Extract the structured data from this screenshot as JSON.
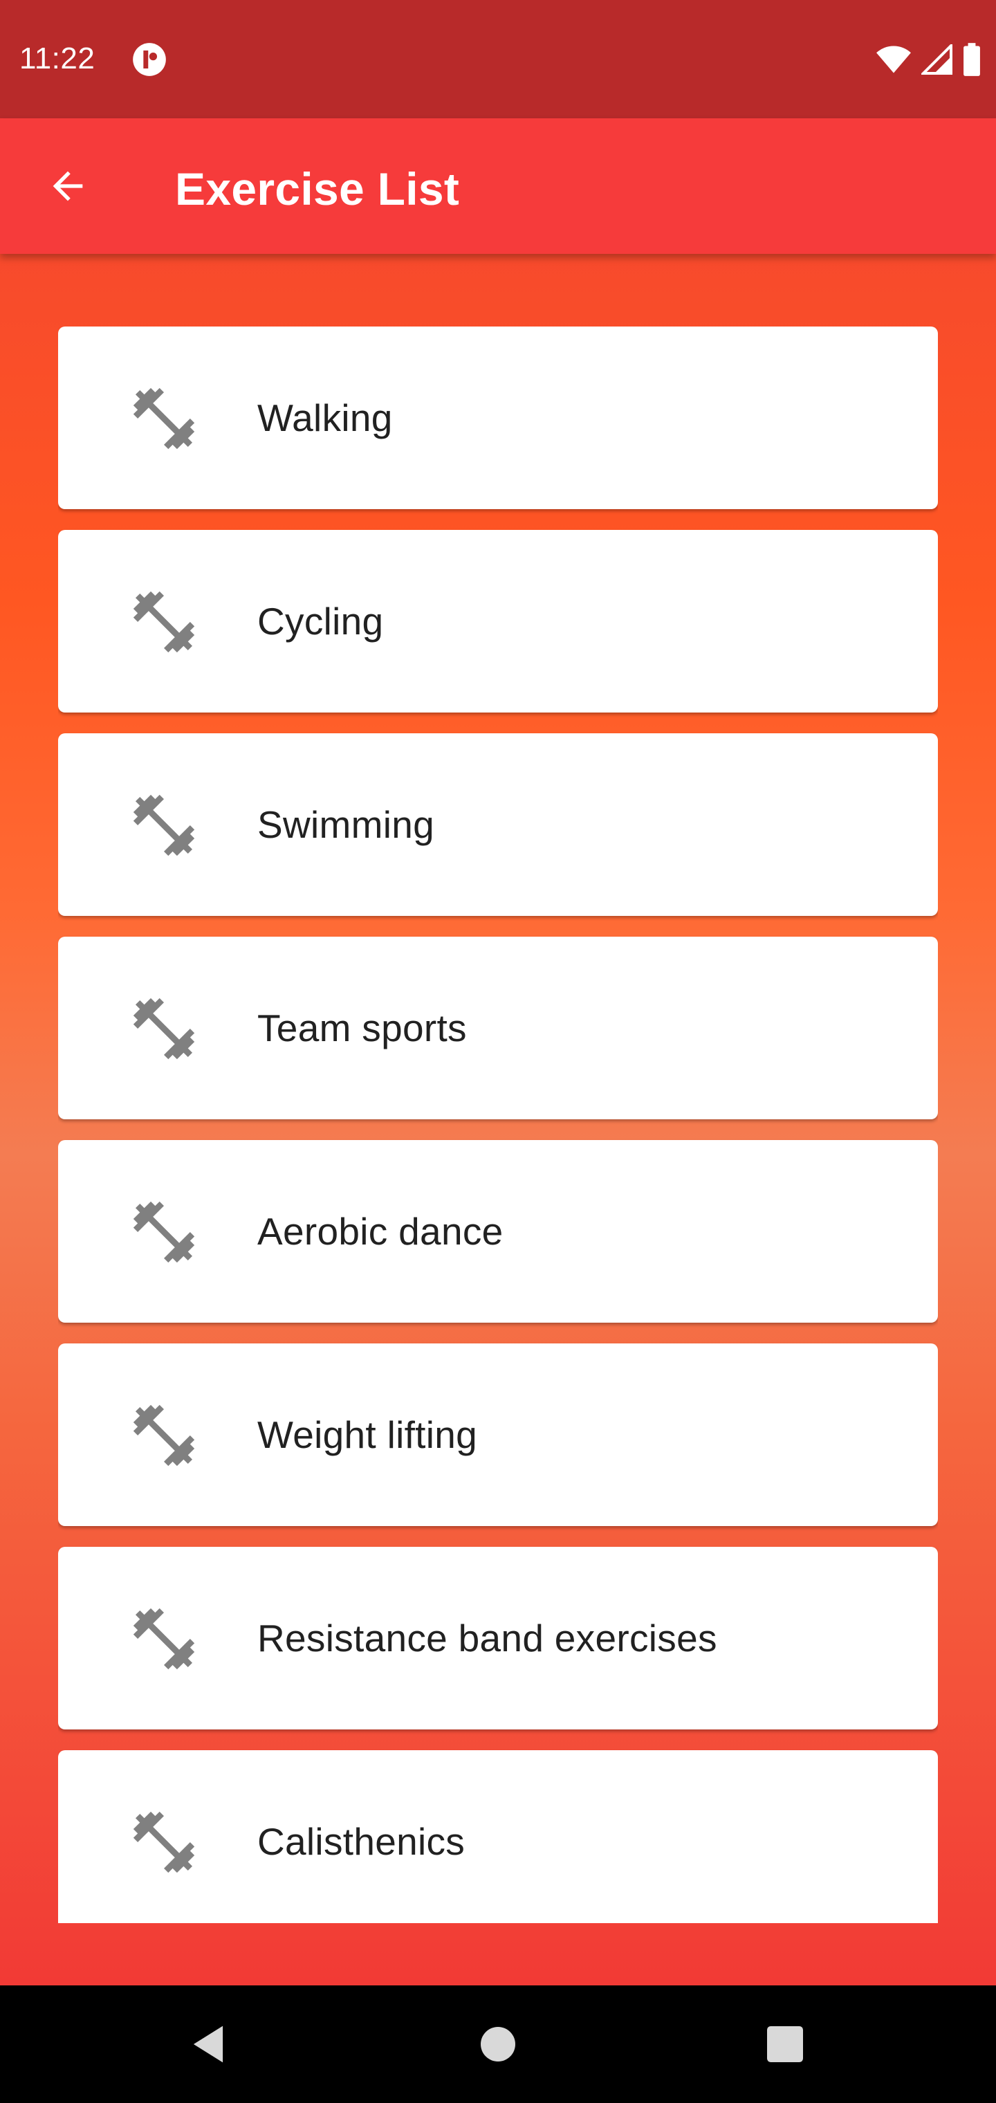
{
  "status_bar": {
    "time": "11:22",
    "icons": [
      "app-notification-icon",
      "wifi-icon",
      "cell-signal-icon",
      "battery-icon"
    ]
  },
  "app_bar": {
    "back_icon": "arrow-back-icon",
    "title": "Exercise List"
  },
  "exercises": [
    {
      "label": "Walking",
      "icon": "dumbbell-icon"
    },
    {
      "label": "Cycling",
      "icon": "dumbbell-icon"
    },
    {
      "label": "Swimming",
      "icon": "dumbbell-icon"
    },
    {
      "label": "Team sports",
      "icon": "dumbbell-icon"
    },
    {
      "label": "Aerobic dance",
      "icon": "dumbbell-icon"
    },
    {
      "label": "Weight lifting",
      "icon": "dumbbell-icon"
    },
    {
      "label": "Resistance band exercises",
      "icon": "dumbbell-icon"
    },
    {
      "label": "Calisthenics",
      "icon": "dumbbell-icon"
    }
  ],
  "nav_bar": {
    "icons": [
      "nav-back-icon",
      "nav-home-icon",
      "nav-recents-icon"
    ]
  },
  "colors": {
    "status_bar": "#b82a2a",
    "app_bar": "#f63b3b",
    "gradient_top": "#f74a2c",
    "gradient_mid": "#ff5722",
    "gradient_bottom": "#f23a35",
    "card": "#ffffff",
    "icon": "#808080",
    "text": "#212121"
  }
}
